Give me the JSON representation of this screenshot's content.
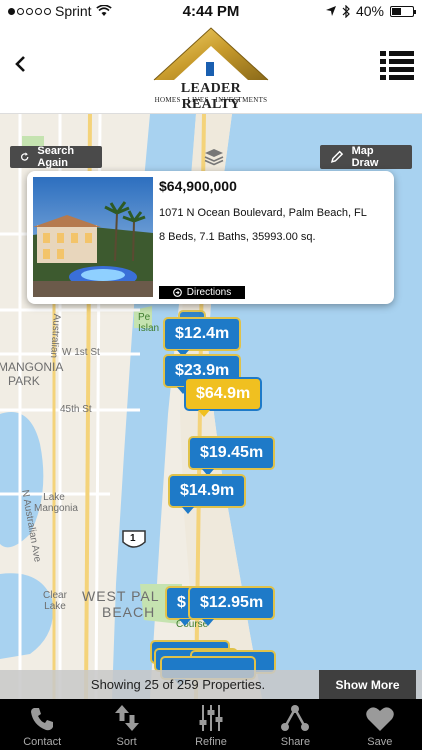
{
  "status_bar": {
    "carrier": "Sprint",
    "time": "4:44 PM",
    "battery": "40%",
    "signal_dots_filled": 1,
    "signal_dots_total": 5
  },
  "header": {
    "logo_name": "LEADER REALTY",
    "logo_tagline": "HOMES · LIVES · INVESTMENTS"
  },
  "map": {
    "search_again_label": "Search Again",
    "map_draw_label": "Map Draw",
    "labels": {
      "mangonia": "MANGONIA",
      "park": "PARK",
      "w1st": "W 1st St",
      "st45": "45th St",
      "n_australian": "N Australian Ave",
      "australian": "Australian",
      "lake_mangonia": "Lake Mangonia",
      "clear_lake": "Clear Lake",
      "west_palm": "WEST PAL",
      "beach": "BEACH",
      "peanut_island": "Pe Islan",
      "route": "1",
      "course": "Course"
    }
  },
  "popup": {
    "price": "$64,900,000",
    "address": "1071 N Ocean Boulevard, Palm Beach, FL",
    "details": "8 Beds, 7.1 Baths, 35993.00 sq.",
    "directions_label": "Directions"
  },
  "pins": [
    {
      "label": "$12.4m"
    },
    {
      "label": "$23.9m"
    },
    {
      "label": "$64.9m"
    },
    {
      "label": "$19.45m"
    },
    {
      "label": "$14.9m"
    },
    {
      "label": "$"
    },
    {
      "label": "$12.95m"
    }
  ],
  "results": {
    "showing_text": "Showing 25 of 259 Properties.",
    "show_more_label": "Show More"
  },
  "tabs": [
    {
      "label": "Contact",
      "icon": "phone-icon"
    },
    {
      "label": "Sort",
      "icon": "sort-icon"
    },
    {
      "label": "Refine",
      "icon": "sliders-icon"
    },
    {
      "label": "Share",
      "icon": "share-icon"
    },
    {
      "label": "Save",
      "icon": "heart-icon"
    }
  ],
  "colors": {
    "pin_blue": "#1e7ac8",
    "pin_gold": "#f0c020",
    "water": "#a8d2f0"
  }
}
